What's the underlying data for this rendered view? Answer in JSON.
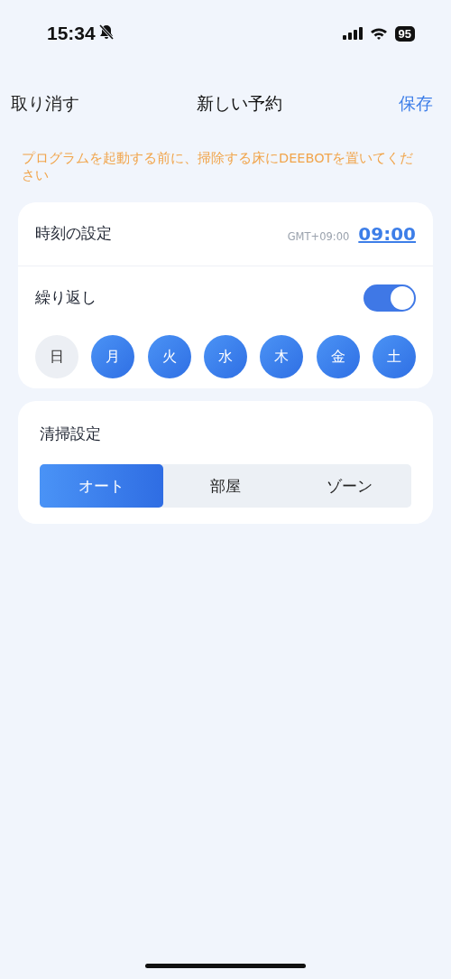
{
  "status_bar": {
    "time": "15:34",
    "silent": true,
    "battery": "95"
  },
  "nav": {
    "cancel": "取り消す",
    "title": "新しい予約",
    "save": "保存"
  },
  "notice": "プログラムを起動する前に、掃除する床にDEEBOTを置いてください",
  "schedule": {
    "time_label": "時刻の設定",
    "timezone": "GMT+09:00",
    "time": "09:00",
    "repeat_label": "繰り返し",
    "repeat_on": true,
    "days": [
      {
        "label": "日",
        "selected": false
      },
      {
        "label": "月",
        "selected": true
      },
      {
        "label": "火",
        "selected": true
      },
      {
        "label": "水",
        "selected": true
      },
      {
        "label": "木",
        "selected": true
      },
      {
        "label": "金",
        "selected": true
      },
      {
        "label": "土",
        "selected": true
      }
    ]
  },
  "cleaning": {
    "title": "清掃設定",
    "modes": [
      {
        "label": "オート",
        "selected": true
      },
      {
        "label": "部屋",
        "selected": false
      },
      {
        "label": "ゾーン",
        "selected": false
      }
    ]
  }
}
